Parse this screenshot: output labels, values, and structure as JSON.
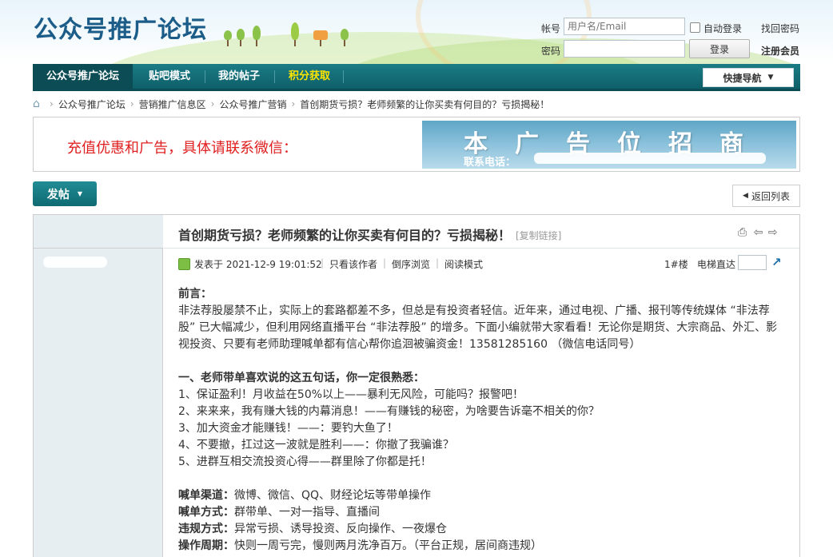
{
  "site": {
    "logo": "公众号推广论坛"
  },
  "login": {
    "username_label": "帐号",
    "username_placeholder": "用户名/Email",
    "auto_login": "自动登录",
    "find_password": "找回密码",
    "password_label": "密码",
    "login_button": "登录",
    "register": "注册会员"
  },
  "nav": {
    "items": [
      "公众号推广论坛",
      "贴吧模式",
      "我的帖子",
      "积分获取"
    ],
    "highlight_color": "#ffe500",
    "quick_nav": "快捷导航"
  },
  "breadcrumb": [
    "公众号推广论坛",
    "营销推广信息区",
    "公众号推广营销",
    "首创期货亏损？老师频繁的让你买卖有何目的？亏损揭秘！"
  ],
  "ad": {
    "left_text": "充值优惠和广告，具体请联系微信：",
    "right_big": "本广告位招商",
    "right_small": "联系电话："
  },
  "buttons": {
    "post": "发帖",
    "back_list": "返回列表"
  },
  "thread": {
    "title": "首创期货亏损？老师频繁的让你买卖有何目的？亏损揭秘！",
    "copy_link": "[复制链接]",
    "posted_at": "发表于 2021-12-9 19:01:52",
    "only_author": "只看该作者",
    "reverse": "倒序浏览",
    "read_mode": "阅读模式",
    "floor": "1#楼",
    "floor_jump": "电梯直达"
  },
  "content": {
    "preface_title": "前言：",
    "preface_lines": [
      "非法荐股屡禁不止，实际上的套路都差不多，但总是有投资者轻信。近年来，通过电视、广播、报刊等传统媒体 “非法荐",
      "股” 已大幅减少，但利用网络直播平台 “非法荐股” 的增多。下面小编就带大家看看！无论你是期货、大宗商品、外汇、影",
      "视投资、只要有老师助理喊单都有信心帮你追洄被骗资金！13581285160 （微信电话同号）"
    ],
    "section1_title": "一、老师带单喜欢说的这五句话，你一定很熟悉：",
    "section1_items": [
      "1、保证盈利！月收益在50%以上——暴利无风险，可能吗？报警吧！",
      "2、来来来，我有赚大钱的内幕消息！——有赚钱的秘密，为啥要告诉毫不相关的你？",
      "3、加大资金才能赚钱！——：要钓大鱼了！",
      "4、不要撤，扛过这一波就是胜利——：你撤了我骗谁？",
      "5、进群互相交流投资心得——群里除了你都是托！"
    ],
    "facts": [
      {
        "label": "喊单渠道：",
        "value": "微博、微信、QQ、财经论坛等带单操作"
      },
      {
        "label": "喊单方式：",
        "value": "群带单、一对一指导、直播间"
      },
      {
        "label": "违规方式：",
        "value": "异常亏损、诱导投资、反向操作、一夜爆仓"
      },
      {
        "label": "操作周期：",
        "value": "快则一周亏完，慢则两月洗净百万。（平台正规，居间商违规）"
      }
    ]
  }
}
